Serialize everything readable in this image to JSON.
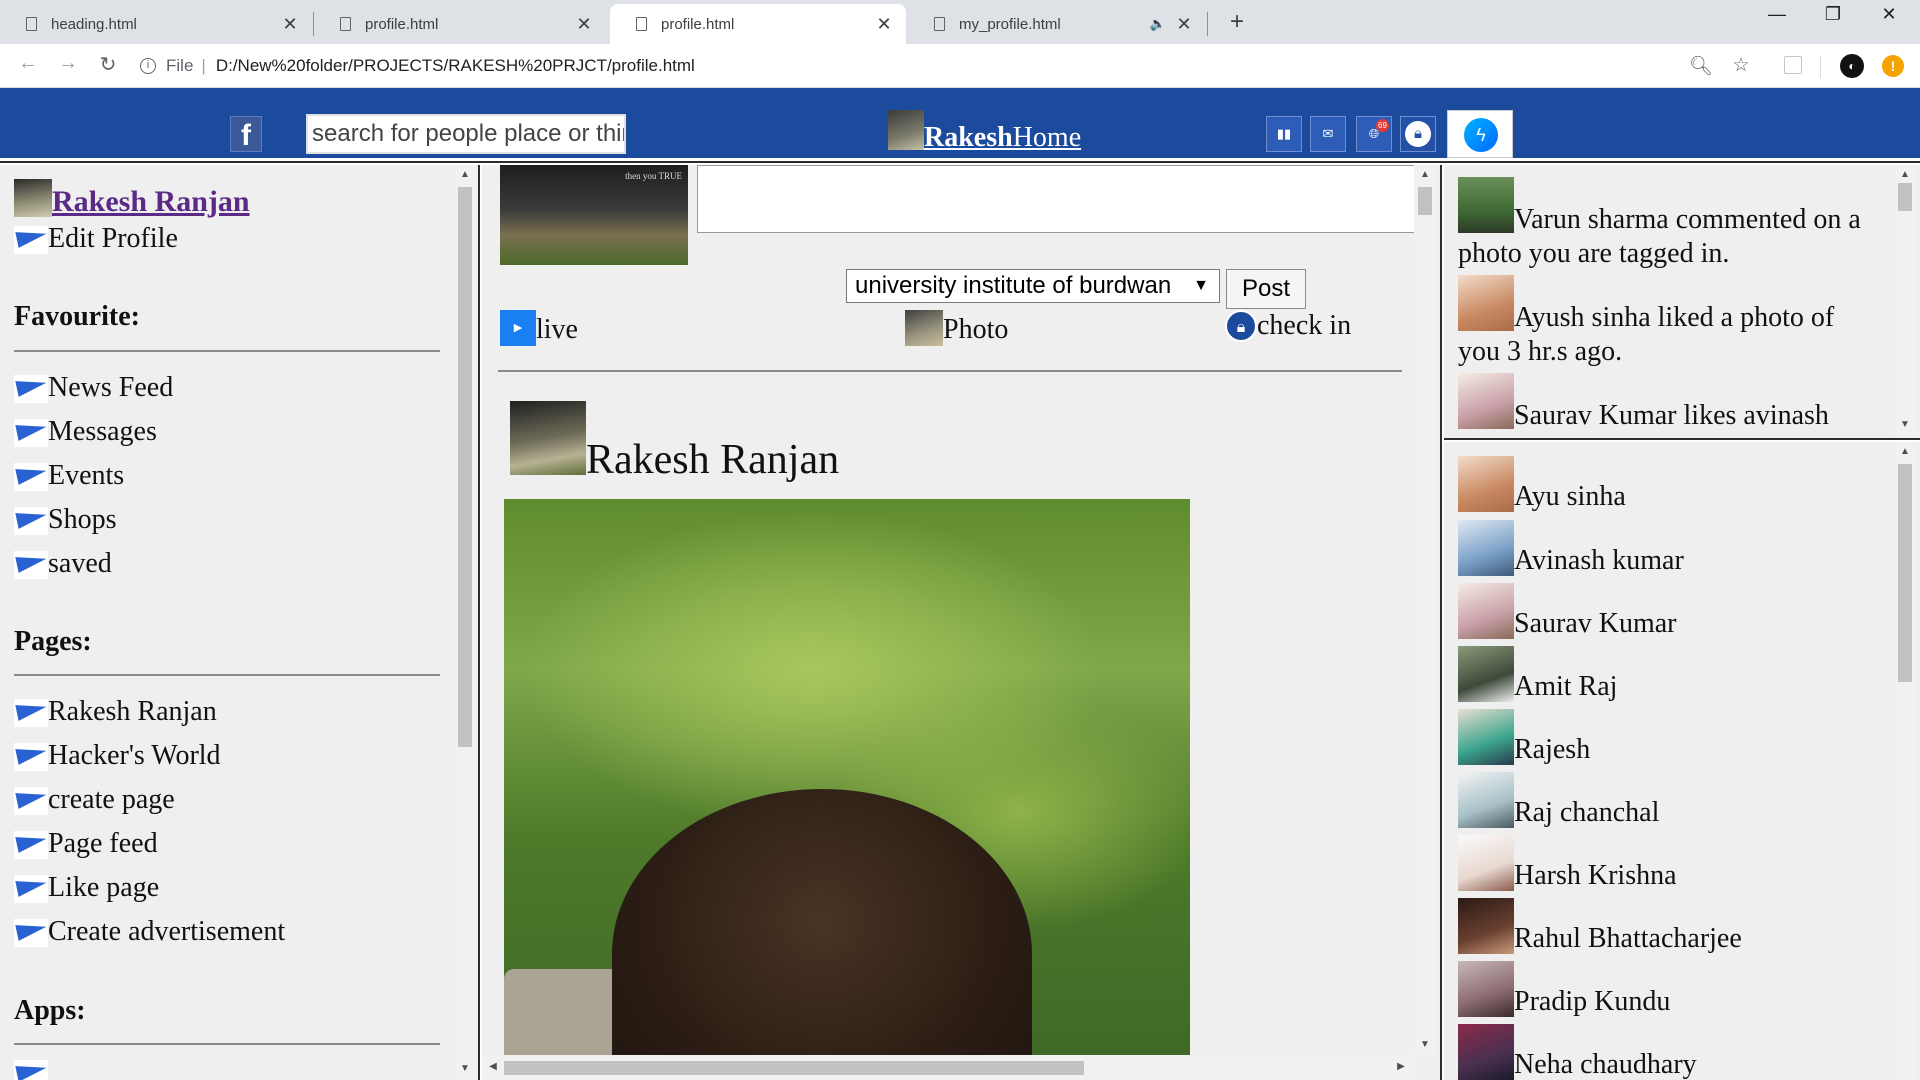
{
  "browser": {
    "tabs": [
      {
        "title": "heading.html",
        "active": false
      },
      {
        "title": "profile.html",
        "active": false
      },
      {
        "title": "profile.html",
        "active": true
      },
      {
        "title": "my_profile.html",
        "active": false,
        "audio": true
      }
    ],
    "address": {
      "scheme_label": "File",
      "url": "D:/New%20folder/PROJECTS/RAKESH%20PRJCT/profile.html"
    }
  },
  "header": {
    "search_placeholder": "search for people place or things",
    "brand_bold": "Rakesh",
    "brand_rest": "Home",
    "notif_count": "69"
  },
  "left": {
    "profile_name": "Rakesh Ranjan",
    "edit_profile": "Edit Profile",
    "favourite_title": "Favourite:",
    "favourites": [
      "News Feed",
      "Messages",
      "Events",
      "Shops",
      "saved"
    ],
    "pages_title": "Pages:",
    "pages": [
      "Rakesh Ranjan",
      "Hacker's World",
      "create page",
      "Page feed",
      "Like page",
      "Create advertisement"
    ],
    "apps_title": "Apps:"
  },
  "composer": {
    "place_selected": "university institute of burdwan",
    "post_label": "Post",
    "live_label": "live",
    "photo_label": "Photo",
    "checkin_label": "check in",
    "thumb_text": "then you TRUE"
  },
  "feed": {
    "author": "Rakesh Ranjan"
  },
  "notifications": [
    {
      "text": "Varun sharma commented on a photo you are tagged in.",
      "color": "#4c7a3a"
    },
    {
      "text": "Ayush sinha liked a photo of you 3 hr.s ago.",
      "color": "#c98a62"
    },
    {
      "text": "Saurav Kumar likes avinash",
      "color": "#c9a0a8"
    }
  ],
  "friends": [
    {
      "name": "Ayu sinha",
      "color": "#c98a62"
    },
    {
      "name": "Avinash kumar",
      "color": "#7aa0c8"
    },
    {
      "name": "Saurav Kumar",
      "color": "#c9a0a8"
    },
    {
      "name": "Amit Raj",
      "color": "#3e4a3a"
    },
    {
      "name": "Rajesh",
      "color": "#3aa38c"
    },
    {
      "name": "Raj chanchal",
      "color": "#a8c0c8"
    },
    {
      "name": "Harsh Krishna",
      "color": "#e8d8d0"
    },
    {
      "name": "Rahul Bhattacharjee",
      "color": "#6a4030"
    },
    {
      "name": "Pradip Kundu",
      "color": "#8a6a70"
    },
    {
      "name": "Neha chaudhary",
      "color": "#4a3050"
    }
  ]
}
